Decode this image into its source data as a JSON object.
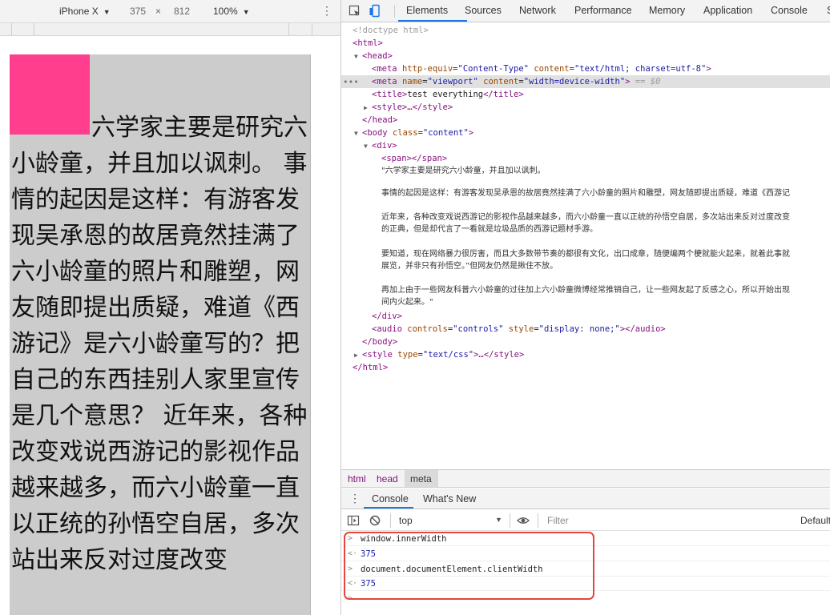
{
  "device_toolbar": {
    "device": "iPhone X",
    "width": "375",
    "separator": "×",
    "height": "812",
    "zoom": "100%"
  },
  "page": {
    "text": "六学家主要是研究六小龄童，并且加以讽刺。 事情的起因是这样：有游客发现吴承恩的故居竟然挂满了六小龄童的照片和雕塑，网友随即提出质疑，难道《西游记》是六小龄童写的？把自己的东西挂别人家里宣传是几个意思？ 近年来，各种改变戏说西游记的影视作品越来越多，而六小龄童一直以正统的孙悟空自居，多次站出来反对过度改变",
    "box_color": "#ff3e8d"
  },
  "devtools": {
    "tabs": [
      "Elements",
      "Sources",
      "Network",
      "Performance",
      "Memory",
      "Application",
      "Console",
      "S"
    ],
    "active_tab": "Elements",
    "accent": "#1a73e8"
  },
  "elements": {
    "doctype": "<!doctype html>",
    "html_open": "<html>",
    "head_open": "<head>",
    "meta1": {
      "tag": "meta",
      "a1": "http-equiv",
      "v1": "\"Content-Type\"",
      "a2": "content",
      "v2": "\"text/html; charset=utf-8\""
    },
    "meta2": {
      "tag": "meta",
      "a1": "name",
      "v1": "\"viewport\"",
      "a2": "content",
      "v2": "\"width=device-width\"",
      "eq": " == $0"
    },
    "title": {
      "open": "<title>",
      "text": "test everything",
      "close": "</title>"
    },
    "style_collapsed": "<style>…</style>",
    "head_close": "</head>",
    "body": {
      "tag": "body",
      "a1": "class",
      "v1": "\"content\""
    },
    "div_open": "<div>",
    "span": "<span></span>",
    "text_lines": [
      "\"六学家主要是研究六小龄童，并且加以讽刺。",
      "事情的起因是这样：有游客发现吴承恩的故居竟然挂满了六小龄童的照片和雕塑，网友随即提出质疑，难道《西游记",
      "近年来，各种改变戏说西游记的影视作品越来越多，而六小龄童一直以正统的孙悟空自居，多次站出来反对过度改变",
      "的正典，但是却代言了一看就是垃圾品质的西游记题材手游。",
      "要知道，现在网络暴力很厉害，而且大多数带节奏的都很有文化，出口成章，随便编两个梗就能火起来，就着此事就",
      "展览，并非只有孙悟空。”但网友仍然是揪住不放。",
      "再加上由于一些网友科普六小龄童的过往加上六小龄童微博经常推销自己，让一些网友起了反感之心，所以开始出现",
      "间内火起来。\""
    ],
    "div_close": "</div>",
    "audio": {
      "tag": "audio",
      "a1": "controls",
      "v1": "\"controls\"",
      "a2": "style",
      "v2": "\"display: none;\"",
      "close": "></audio>"
    },
    "body_close": "</body>",
    "style2": {
      "a1": "type",
      "v1": "\"text/css\"",
      "rest": ">…</style>"
    },
    "html_close": "</html>"
  },
  "breadcrumb": [
    "html",
    "head",
    "meta"
  ],
  "drawer": {
    "tabs": [
      "Console",
      "What's New"
    ],
    "context": "top",
    "filter_placeholder": "Filter",
    "levels": "Default"
  },
  "console": {
    "entries": [
      {
        "kind": "input",
        "prefix": ">",
        "text": "window.innerWidth"
      },
      {
        "kind": "result",
        "prefix": "<·",
        "text": "375"
      },
      {
        "kind": "input",
        "prefix": ">",
        "text": "document.documentElement.clientWidth"
      },
      {
        "kind": "result",
        "prefix": "<·",
        "text": "375"
      },
      {
        "kind": "prompt",
        "prefix": ">",
        "text": ""
      }
    ],
    "highlight_color": "#e5463d"
  }
}
